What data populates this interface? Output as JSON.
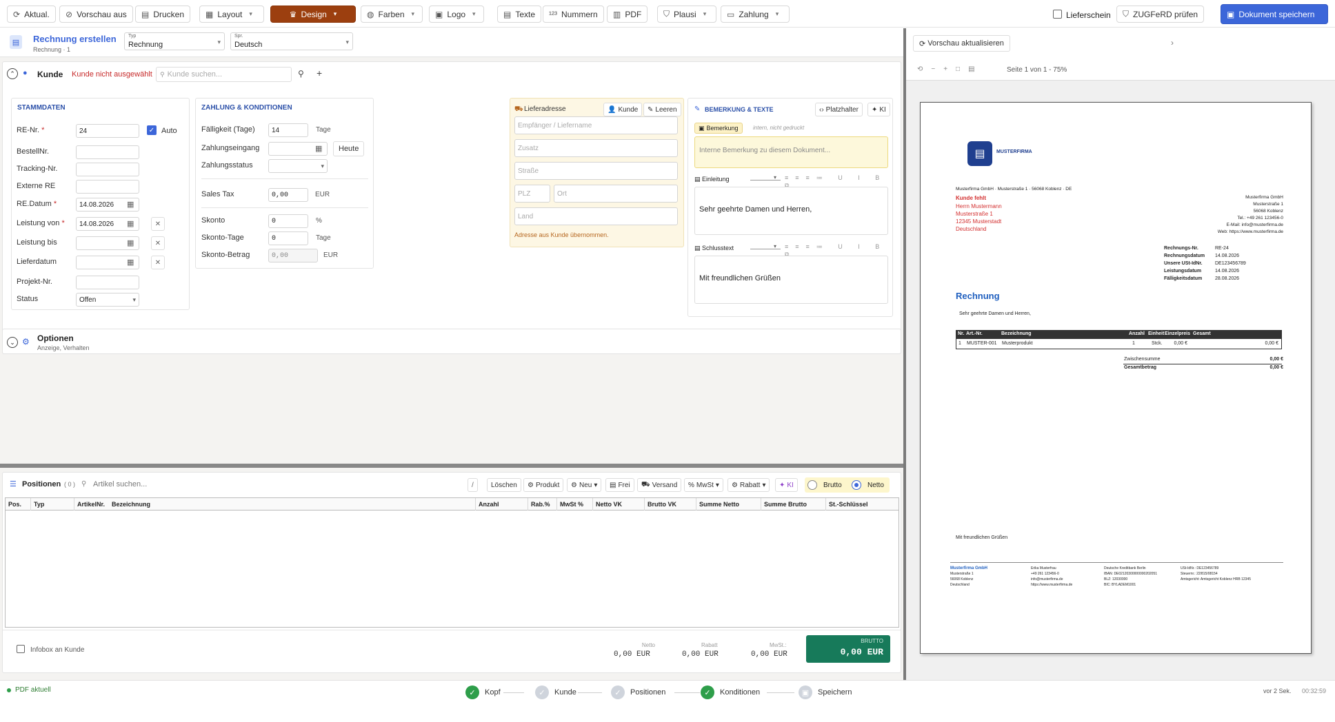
{
  "toolbar": {
    "refresh": "Aktual.",
    "preview_off": "Vorschau aus",
    "print": "Drucken",
    "layout": "Layout",
    "design": "Design",
    "colors": "Farben",
    "logo": "Logo",
    "texts": "Texte",
    "numbers": "Nummern",
    "pdf": "PDF",
    "plausi": "Plausi",
    "payment": "Zahlung",
    "delivery_note": "Lieferschein",
    "zugferd": "ZUGFeRD prüfen",
    "save": "Dokument speichern",
    "accent": "#9c3f0f",
    "save_color": "#3c66d9"
  },
  "header": {
    "title": "Rechnung erstellen",
    "subtitle": "Rechnung · 1",
    "type_label": "Typ",
    "type_value": "Rechnung",
    "lang_label": "Spr.",
    "lang_value": "Deutsch"
  },
  "customer": {
    "label": "Kunde",
    "warning": "Kunde nicht ausgewählt",
    "search_placeholder": "Kunde suchen..."
  },
  "stamm": {
    "title": "STAMMDATEN",
    "re_nr_label": "RE-Nr.",
    "re_nr": "24",
    "auto": "Auto",
    "bestell": "BestellNr.",
    "tracking": "Tracking-Nr.",
    "extern": "Externe RE",
    "datum_label": "RE.Datum",
    "datum": "14.08.2026",
    "leistung_von_label": "Leistung von",
    "leistung_von": "14.08.2026",
    "leistung_bis_label": "Leistung bis",
    "lieferdatum_label": "Lieferdatum",
    "projekt": "Projekt-Nr.",
    "status_label": "Status",
    "status": "Offen",
    "req": "*"
  },
  "zahlung": {
    "title": "ZAHLUNG & KONDITIONEN",
    "faellig_label": "Fälligkeit (Tage)",
    "faellig": "14",
    "tage": "Tage",
    "eingang": "Zahlungseingang",
    "heute": "Heute",
    "zstatus": "Zahlungsstatus",
    "sales_tax": "Sales Tax",
    "sales_tax_val": "0,00",
    "eur": "EUR",
    "skonto": "Skonto",
    "skonto_val": "0",
    "pct": "%",
    "skonto_tage": "Skonto-Tage",
    "skonto_tage_val": "0",
    "skonto_betrag": "Skonto-Betrag",
    "skonto_betrag_val": "0,00"
  },
  "liefer": {
    "title": "Lieferadresse",
    "kunde": "Kunde",
    "leeren": "Leeren",
    "empf": "Empfänger / Liefername",
    "zusatz": "Zusatz",
    "strasse": "Straße",
    "plz": "PLZ",
    "ort": "Ort",
    "land": "Land",
    "note": "Adresse aus Kunde übernommen."
  },
  "bem": {
    "title": "BEMERKUNG & TEXTE",
    "platzhalter": "Platzhalter",
    "ki": "KI",
    "tag": "Bemerkung",
    "tag_note": "intern, nicht gedruckt",
    "placeholder": "Interne Bemerkung zu diesem Dokument...",
    "einleitung": "Einleitung",
    "einleitung_text": "Sehr geehrte Damen und Herren,",
    "schluss": "Schlusstext",
    "schluss_text": "Mit freundlichen Grüßen"
  },
  "optionen": {
    "title": "Optionen",
    "sub": "Anzeige, Verhalten"
  },
  "positions": {
    "title": "Positionen",
    "count": "( 0 )",
    "search": "Artikel suchen...",
    "slash": "/",
    "loeschen": "Löschen",
    "produkt": "Produkt",
    "neu": "Neu",
    "frei": "Frei",
    "versand": "Versand",
    "mwst": "MwSt",
    "rabatt": "Rabatt",
    "ki": "KI",
    "brutto": "Brutto",
    "netto": "Netto",
    "columns": [
      "Pos.",
      "Typ",
      "ArtikelNr.",
      "Bezeichnung",
      "Anzahl",
      "Rab.%",
      "MwSt %",
      "Netto VK",
      "Brutto VK",
      "Summe Netto",
      "Summe Brutto",
      "St.-Schlüssel"
    ]
  },
  "totals": {
    "infobox": "Infobox an Kunde",
    "netto_label": "Netto",
    "netto": "0,00 EUR",
    "rabatt_label": "Rabatt",
    "rabatt": "0,00 EUR",
    "mwst_label": "MwSt.:",
    "mwst": "0,00 EUR",
    "brutto_label": "BRUTTO",
    "brutto": "0,00 EUR"
  },
  "preview": {
    "refresh": "Vorschau aktualisieren",
    "page": "Seite 1 von 1 - 75%"
  },
  "document": {
    "company": "MUSTERFIRMA",
    "sender_line": "Musterfirma GmbH · Musterstraße 1 · 56068 Koblenz · DE",
    "kunde_fehlt": "Kunde fehlt",
    "addr1": "Herrn Mustermann",
    "addr2": "Musterstraße 1",
    "addr3": "12345 Musterstadt",
    "addr4": "Deutschland",
    "r1": "Musterfirma GmbH",
    "r2": "Musterstraße 1",
    "r3": "56068 Koblenz",
    "r4": "Tel.: +49 261 123456-0",
    "r5": "E-Mail: info@musterfirma.de",
    "r6": "Web: https://www.musterfirma.de",
    "meta": [
      [
        "Rechnungs-Nr.",
        "RE-24"
      ],
      [
        "Rechnungsdatum",
        "14.08.2026"
      ],
      [
        "Unsere USt-IdNr.",
        "DE123456789"
      ],
      [
        "Leistungsdatum",
        "14.08.2026"
      ],
      [
        "Fälligkeitsdatum",
        "28.08.2026"
      ]
    ],
    "heading": "Rechnung",
    "greeting": "Sehr geehrte Damen und Herren,",
    "table_head": [
      "Nr.",
      "Art.-Nr.",
      "Bezeichnung",
      "Anzahl",
      "Einheit",
      "Einzelpreis",
      "Gesamt"
    ],
    "table_row": [
      "1",
      "MUSTER-001",
      "Musterprodukt",
      "1",
      "Stck.",
      "0,00 €",
      "0,00 €"
    ],
    "zwischen": "Zwischensumme",
    "zwischen_val": "0,00 €",
    "gesamt": "Gesamtbetrag",
    "gesamt_val": "0,00 €",
    "closing": "Mit freundlichen Grüßen",
    "f1": [
      "Musterfirma GmbH",
      "Musterstraße 1",
      "56068 Koblenz",
      "Deutschland"
    ],
    "f2": [
      "Erika Musterfrau",
      "+49 261 123456-0",
      "info@musterfirma.de",
      "https://www.musterfirma.de"
    ],
    "f3": [
      "Deutsche Kreditbank Berlin",
      "IBAN: DE02120300000000202051",
      "BLZ: 12030000",
      "BIC: BYLADEM1001"
    ],
    "f4": [
      "USt-IdNr.: DE123456789",
      "Steuernr.: 22/815/08154",
      "Amtsgericht: Amtsgericht Koblenz HRB 12345"
    ],
    "accent": "#1f5fbf",
    "red": "#d32f2f"
  },
  "footer": {
    "pdf": "PDF aktuell",
    "steps": [
      "Kopf",
      "Kunde",
      "Positionen",
      "Konditionen",
      "Speichern"
    ],
    "time": "vor 2 Sek.",
    "clock": "00:32:59"
  }
}
